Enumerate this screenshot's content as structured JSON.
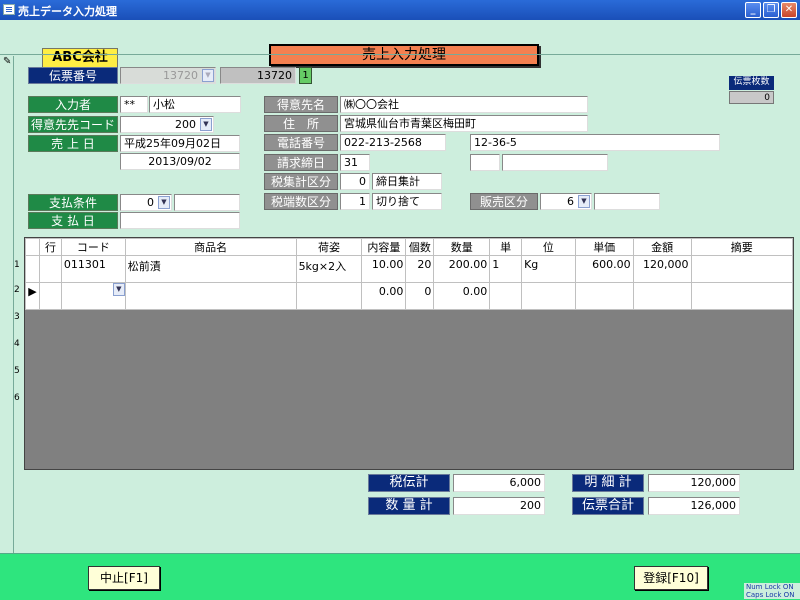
{
  "window": {
    "title": "売上データ入力処理",
    "min": "_",
    "max": "❐",
    "close": "✕"
  },
  "company": "ABC会社",
  "form_title": "売上入力処理",
  "slip_count": {
    "label": "伝票枚数",
    "value": "0"
  },
  "header": {
    "slip_no_label": "伝票番号",
    "slip_no_combo": "13720",
    "slip_no_value": "13720",
    "slip_no_button": "1",
    "entry_person_label": "入力者",
    "entry_person_code": "**",
    "entry_person_name": "小松",
    "customer_code_label": "得意先先コード",
    "customer_code_value": "200",
    "sales_date_label": "売 上 日",
    "sales_date_wareki": "平成25年09月02日",
    "sales_date_iso": "2013/09/02",
    "customer_name_label": "得意先名",
    "customer_name": "㈱〇〇会社",
    "address_label": "住　所",
    "address": "宮城県仙台市青葉区梅田町",
    "phone_label": "電話番号",
    "phone": "022-213-2568",
    "address2": "12-36-5",
    "closing_day_label": "請求締日",
    "closing_day": "31",
    "tax_calc_label": "税集計区分",
    "tax_calc_code": "0",
    "tax_calc_name": "締日集計",
    "tax_round_label": "税端数区分",
    "tax_round_code": "1",
    "tax_round_name": "切り捨て",
    "payment_terms_label": "支払条件",
    "payment_terms_value": "0",
    "payment_date_label": "支 払 日",
    "sales_type_label": "販売区分",
    "sales_type_value": "6"
  },
  "grid": {
    "columns": [
      "行",
      "コード",
      "商品名",
      "荷姿",
      "内容量",
      "個数",
      "数量",
      "単",
      "位",
      "単価",
      "金額",
      "摘要"
    ],
    "row_numbers": [
      "1",
      "2",
      "3",
      "4",
      "5",
      "6"
    ],
    "rows": [
      {
        "line": "",
        "code": "011301",
        "name": "松前漬",
        "pack": "5kg×2入",
        "content": "10.00",
        "count": "20",
        "qty": "200.00",
        "unit1": "1",
        "unit2": "Kg",
        "price": "600.00",
        "amount": "120,000",
        "note": ""
      },
      {
        "line": "▶",
        "code": "",
        "name": "",
        "pack": "",
        "content": "0.00",
        "count": "0",
        "qty": "0.00",
        "unit1": "",
        "unit2": "",
        "price": "",
        "amount": "",
        "note": ""
      }
    ]
  },
  "totals": {
    "tax_label": "税伝計",
    "tax_value": "6,000",
    "qty_label": "数 量 計",
    "qty_value": "200",
    "detail_label": "明 細 計",
    "detail_value": "120,000",
    "slip_label": "伝票合計",
    "slip_value": "126,000"
  },
  "footer": {
    "cancel": "中止[F1]",
    "register": "登録[F10]"
  },
  "status": {
    "num_lock": "Num Lock ON",
    "caps_lock": "Caps Lock ON"
  }
}
